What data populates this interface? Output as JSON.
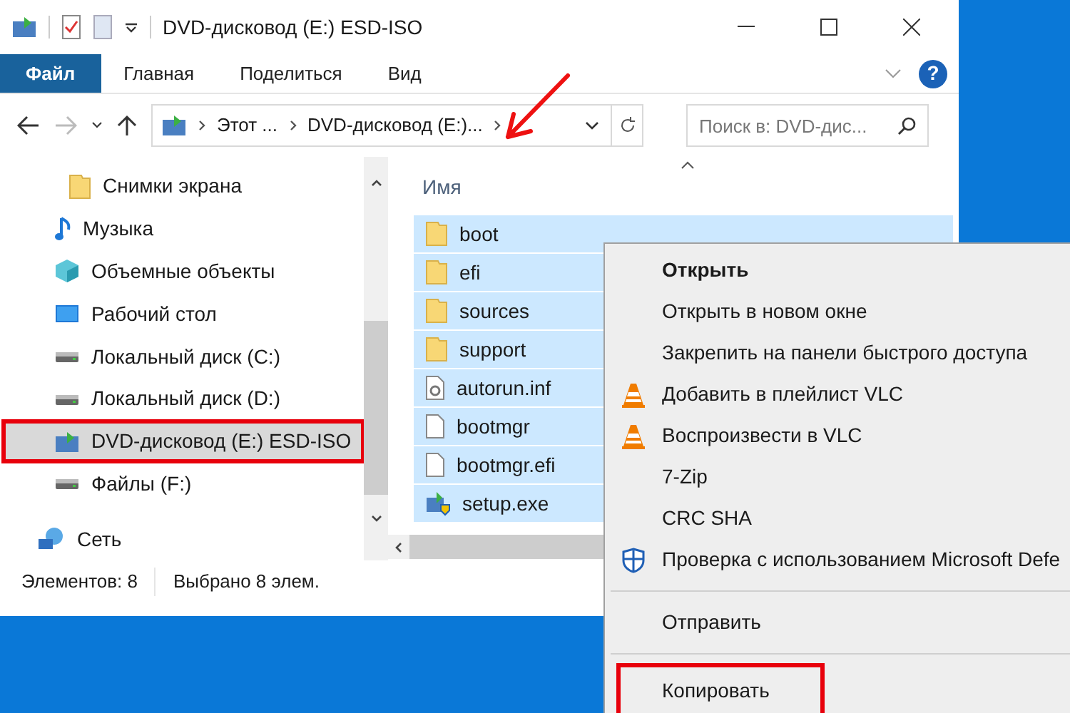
{
  "window": {
    "title": "DVD-дисковод (E:) ESD-ISO"
  },
  "ribbon_tabs": [
    {
      "label": "Файл",
      "selected": true
    },
    {
      "label": "Главная",
      "selected": false
    },
    {
      "label": "Поделиться",
      "selected": false
    },
    {
      "label": "Вид",
      "selected": false
    }
  ],
  "help_button": "?",
  "address_bar": {
    "breadcrumbs": [
      "Этот ...",
      "DVD-дисковод (E:)..."
    ]
  },
  "search": {
    "placeholder": "Поиск в: DVD-дис..."
  },
  "sidebar": {
    "items": [
      {
        "label": "Снимки экрана",
        "kind": "folder",
        "selected": false,
        "annotated": false
      },
      {
        "label": "Музыка",
        "kind": "music",
        "selected": false,
        "annotated": false
      },
      {
        "label": "Объемные объекты",
        "kind": "cube",
        "selected": false,
        "annotated": false
      },
      {
        "label": "Рабочий стол",
        "kind": "desktop",
        "selected": false,
        "annotated": false
      },
      {
        "label": "Локальный диск (C:)",
        "kind": "drive",
        "selected": false,
        "annotated": false
      },
      {
        "label": "Локальный диск (D:)",
        "kind": "drive",
        "selected": false,
        "annotated": false
      },
      {
        "label": "DVD-дисковод (E:) ESD-ISO",
        "kind": "dvd",
        "selected": true,
        "annotated": true
      },
      {
        "label": "Файлы (F:)",
        "kind": "drive",
        "selected": false,
        "annotated": false
      },
      {
        "label": "Сеть",
        "kind": "network",
        "selected": false,
        "annotated": false
      }
    ]
  },
  "file_list": {
    "column": "Имя",
    "rows": [
      {
        "name": "boot",
        "kind": "folder",
        "selected": true
      },
      {
        "name": "efi",
        "kind": "folder",
        "selected": true
      },
      {
        "name": "sources",
        "kind": "folder",
        "selected": true
      },
      {
        "name": "support",
        "kind": "folder",
        "selected": true
      },
      {
        "name": "autorun.inf",
        "kind": "settings",
        "selected": true
      },
      {
        "name": "bootmgr",
        "kind": "file",
        "selected": true
      },
      {
        "name": "bootmgr.efi",
        "kind": "file",
        "selected": true
      },
      {
        "name": "setup.exe",
        "kind": "setup",
        "selected": true
      }
    ]
  },
  "status_bar": [
    "Элементов: 8",
    "Выбрано 8 элем."
  ],
  "context_menu": [
    {
      "kind": "item",
      "label": "Открыть",
      "default": true,
      "annotated": false
    },
    {
      "kind": "item",
      "label": "Открыть в новом окне",
      "default": false,
      "annotated": false
    },
    {
      "kind": "item",
      "label": "Закрепить на панели быстрого доступа",
      "default": false,
      "annotated": false
    },
    {
      "kind": "vlc",
      "label": "Добавить в плейлист VLC",
      "default": false,
      "annotated": false
    },
    {
      "kind": "vlc",
      "label": "Воспроизвести в VLC",
      "default": false,
      "annotated": false
    },
    {
      "kind": "item",
      "label": "7-Zip",
      "default": false,
      "annotated": false
    },
    {
      "kind": "item",
      "label": "CRC SHA",
      "default": false,
      "annotated": false
    },
    {
      "kind": "defender",
      "label": "Проверка с использованием Microsoft Defe",
      "default": false,
      "annotated": false
    },
    {
      "kind": "separator"
    },
    {
      "kind": "item",
      "label": "Отправить",
      "default": false,
      "annotated": false
    },
    {
      "kind": "separator"
    },
    {
      "kind": "item",
      "label": "Копировать",
      "default": false,
      "annotated": true
    }
  ]
}
